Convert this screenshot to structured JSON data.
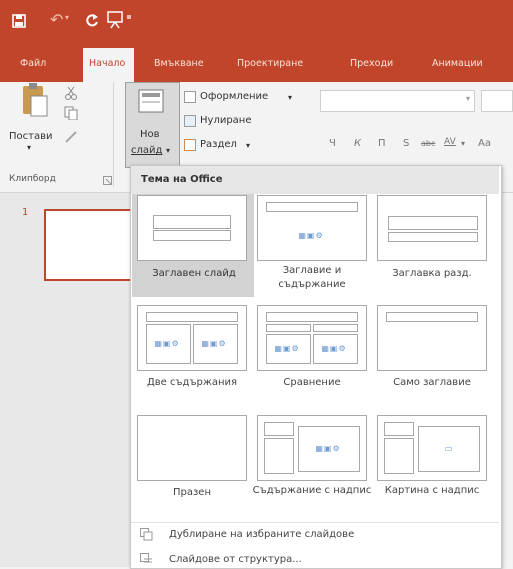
{
  "titlebar": {
    "undo_symbol": "↶",
    "dropdown_symbol": "▾"
  },
  "tabs": [
    {
      "label": "Файл"
    },
    {
      "label": "Начало"
    },
    {
      "label": "Вмъкване"
    },
    {
      "label": "Проектиране"
    },
    {
      "label": "Преходи"
    },
    {
      "label": "Анимации"
    }
  ],
  "ribbon": {
    "paste_label": "Постави",
    "new_slide_line1": "Нов",
    "new_slide_line2": "слайд",
    "layout_label": "Оформление",
    "reset_label": "Нулиране",
    "section_label": "Раздел",
    "clipboard_group": "Клипборд",
    "font_buttons": [
      "Ч",
      "К",
      "П",
      "S",
      "abc",
      "AV",
      "Aa"
    ]
  },
  "slide_pane": {
    "slide_number": "1"
  },
  "dropdown": {
    "header": "Тема на Office",
    "layouts": [
      {
        "label": "Заглавен слайд",
        "selected": true
      },
      {
        "label": "Заглавие и съдържание"
      },
      {
        "label": "Заглавка разд."
      },
      {
        "label": "Две съдържания"
      },
      {
        "label": "Сравнение"
      },
      {
        "label": "Само заглавие"
      },
      {
        "label": "Празен"
      },
      {
        "label": "Съдържание с надпис"
      },
      {
        "label": "Картина с надпис"
      }
    ],
    "menu": [
      {
        "label": "Дублиране на избраните слайдове"
      },
      {
        "label": "Слайдове от структура..."
      }
    ]
  },
  "colors": {
    "accent": "#c1452a",
    "selected_bg": "#d2d2d2"
  }
}
